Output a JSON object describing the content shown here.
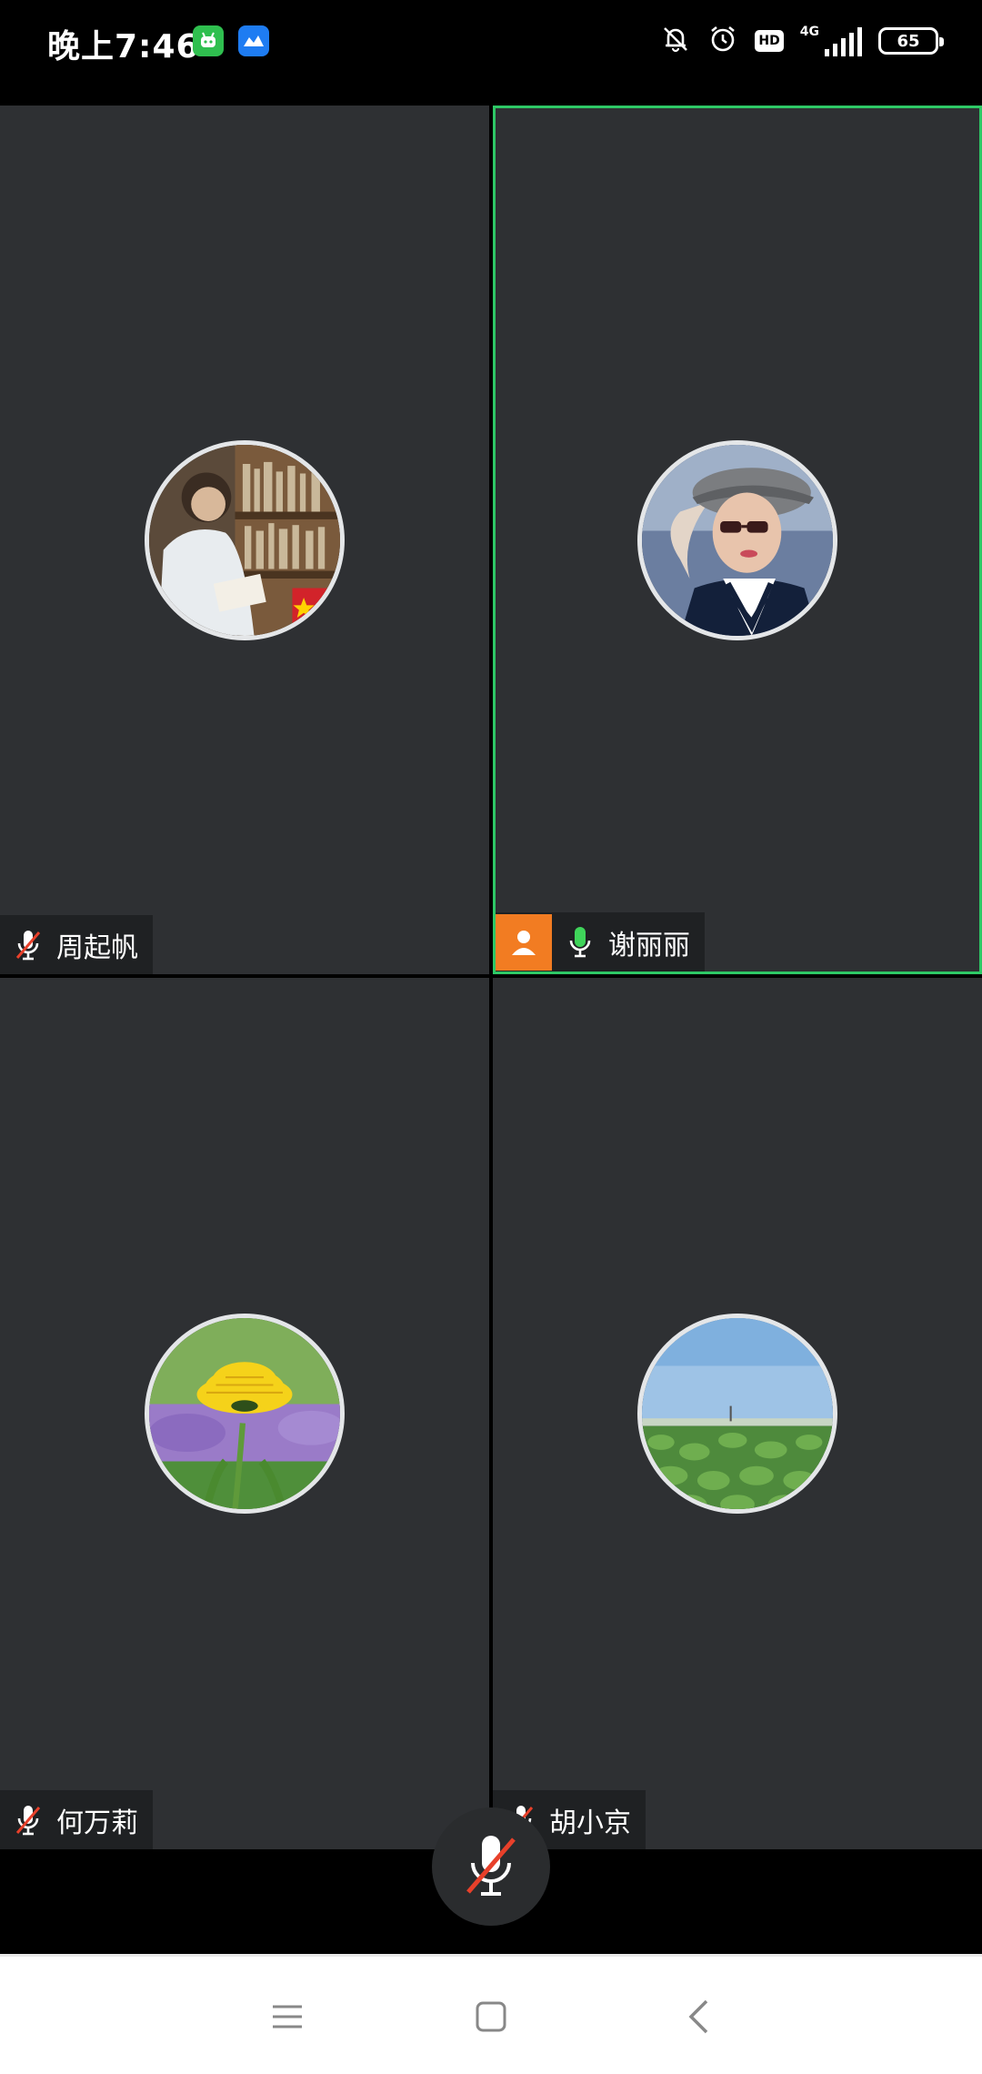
{
  "status_bar": {
    "time": "晚上7:46",
    "hd": "HD",
    "network": "4G",
    "battery": "65"
  },
  "participants": [
    {
      "name": "周起帆",
      "mic": "muted",
      "avatar": "person-reading-bookshelf"
    },
    {
      "name": "谢丽丽",
      "mic": "active",
      "host": true,
      "speaking": true,
      "avatar": "woman-with-cap"
    },
    {
      "name": "何万莉",
      "mic": "muted",
      "avatar": "yellow-dandelion"
    },
    {
      "name": "胡小京",
      "mic": "muted",
      "avatar": "green-field-landscape"
    }
  ],
  "controls": {
    "mic_button_state": "muted"
  },
  "colors": {
    "tile_bg": "#2e3033",
    "speaking_border": "#2ec866",
    "host_badge": "#f27c22",
    "mic_active": "#3fd45a",
    "mic_muted_slash": "#e8402a"
  }
}
